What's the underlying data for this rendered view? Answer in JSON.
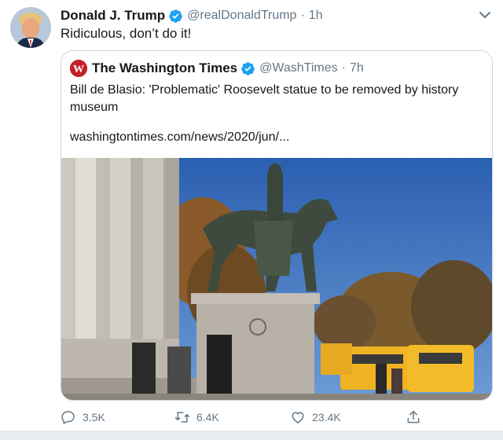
{
  "tweet": {
    "author_name": "Donald J. Trump",
    "author_handle": "@realDonaldTrump",
    "separator": "·",
    "time": "1h",
    "text": "Ridiculous, don’t do it!"
  },
  "quoted": {
    "author_name": "The Washington Times",
    "author_handle": "@WashTimes",
    "separator": "·",
    "time": "7h",
    "text": "Bill de Blasio: 'Problematic' Roosevelt statue to be removed by history museum",
    "url": "washingtontimes.com/news/2020/jun/...",
    "logo_letter": "W"
  },
  "actions": {
    "reply_count": "3.5K",
    "retweet_count": "6.4K",
    "like_count": "23.4K"
  },
  "colors": {
    "accent": "#1da1f2",
    "text": "#14171a",
    "muted": "#657786",
    "border": "#ccd6dd",
    "logo_red": "#c32027"
  },
  "icons": [
    "verified-badge-icon",
    "chevron-down-icon",
    "reply-icon",
    "retweet-icon",
    "like-icon",
    "share-icon"
  ]
}
